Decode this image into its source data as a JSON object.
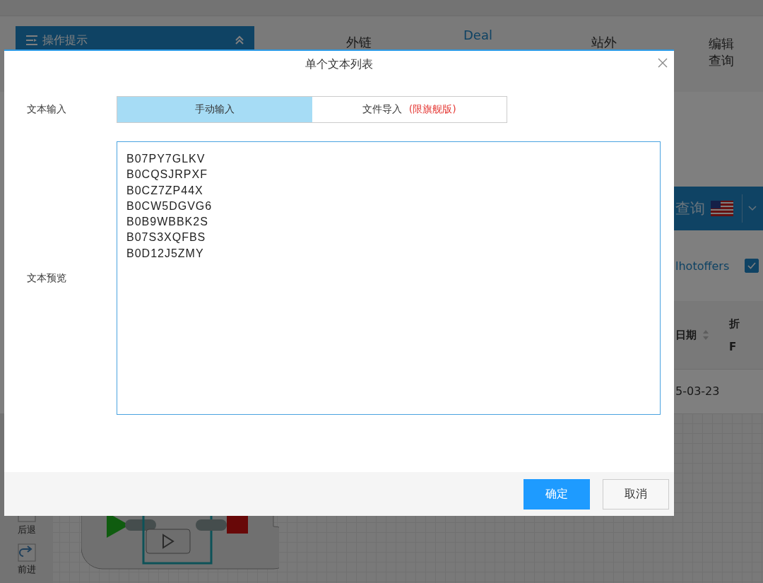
{
  "background": {
    "tips_panel": {
      "title": "操作提示"
    },
    "nav": [
      "外链",
      "Deal",
      "站外",
      "编辑查询"
    ],
    "query_button": "查询",
    "link": "lhotoffers",
    "checkbox": {
      "checked": true
    },
    "table": {
      "columns": [
        "日期",
        "折"
      ],
      "subheader": "F",
      "cell": "5-03-23"
    },
    "toolbar": [
      "后退",
      "前进"
    ]
  },
  "dialog": {
    "title": "单个文本列表",
    "input_label": "文本输入",
    "tabs": [
      {
        "label": "手动输入",
        "selected": true
      },
      {
        "label": "文件导入",
        "note": "(限旗舰版)",
        "selected": false
      }
    ],
    "preview_label": "文本预览",
    "text": "B07PY7GLKV\nB0CQSJRPXF\nB0CZ7ZP44X\nB0CW5DGVG6\nB0B9WBBK2S\nB07S3XQFBS\nB0D12J5ZMY\n",
    "buttons": [
      {
        "label": "确定",
        "kind": "primary"
      },
      {
        "label": "取消",
        "kind": "default"
      }
    ]
  }
}
